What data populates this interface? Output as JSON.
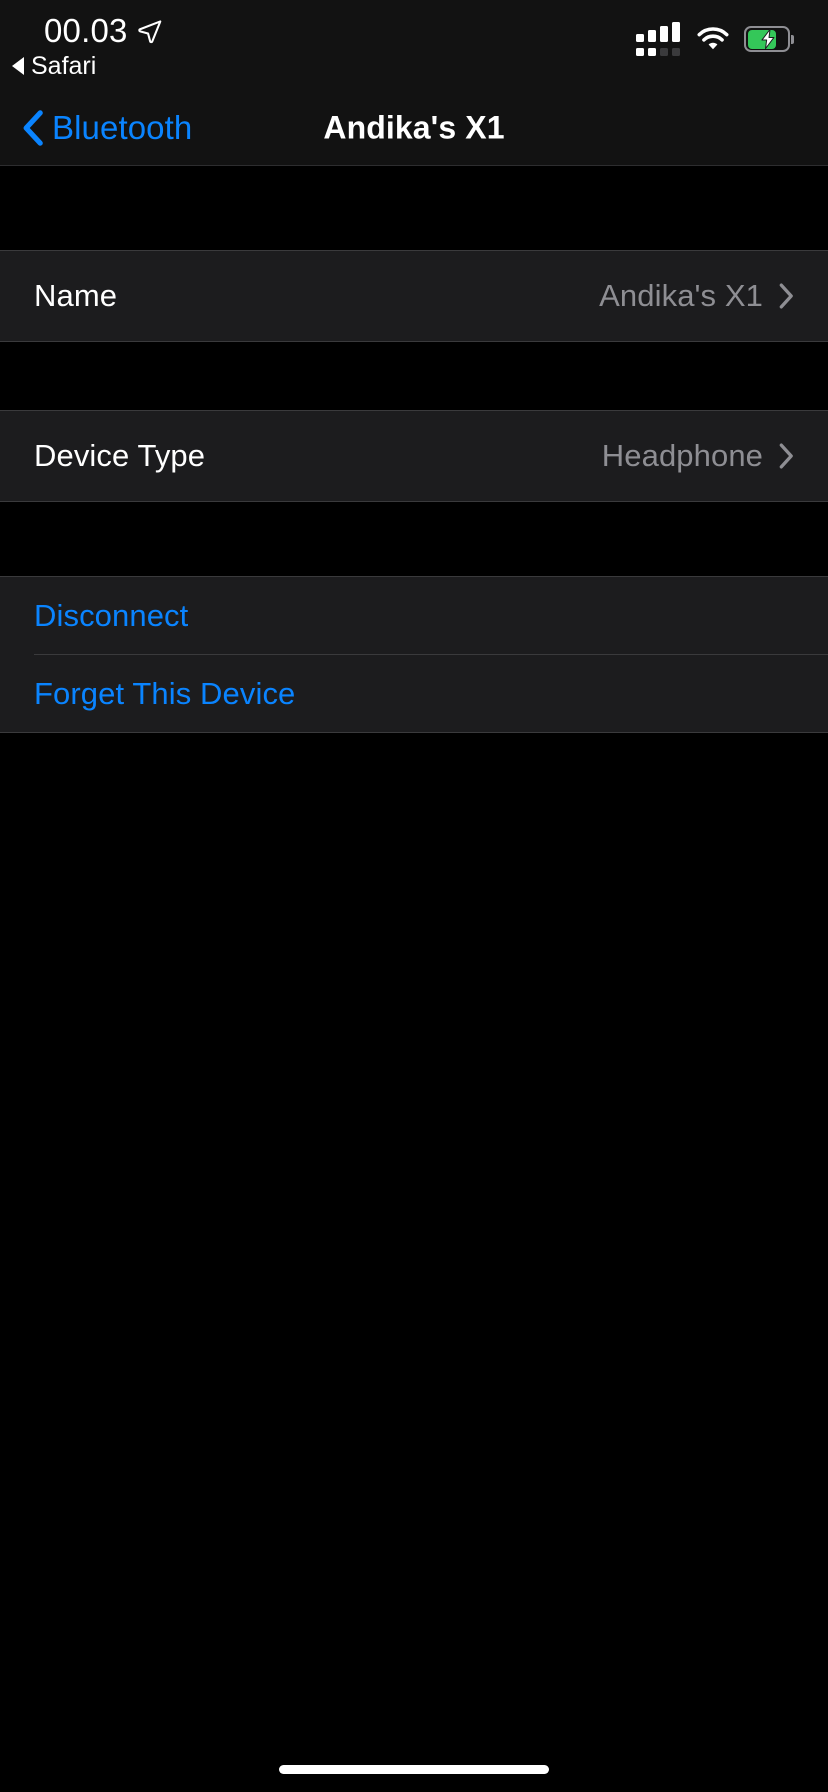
{
  "status_bar": {
    "time": "00.03",
    "location_icon": "location-arrow-icon",
    "return_app_label": "Safari",
    "return_icon": "back-triangle-icon",
    "cellular": {
      "icon": "dual-sim-signal-icon",
      "primary_bars_filled": 4,
      "primary_bars_total": 4,
      "secondary_bars_filled": 2,
      "secondary_bars_total": 4
    },
    "wifi": {
      "icon": "wifi-icon",
      "bars_filled": 3,
      "bars_total": 3
    },
    "battery": {
      "icon": "battery-charging-icon",
      "charging": true,
      "level_percent": 72,
      "fill_color": "#34c759",
      "outline_color": "#8e8e93"
    }
  },
  "nav_bar": {
    "back_icon": "chevron-left-icon",
    "back_label": "Bluetooth",
    "title": "Andika's X1"
  },
  "sections": {
    "name_group": {
      "rows": [
        {
          "label": "Name",
          "value": "Andika's X1",
          "accessory_icon": "chevron-right-icon"
        }
      ]
    },
    "device_type_group": {
      "rows": [
        {
          "label": "Device Type",
          "value": "Headphone",
          "accessory_icon": "chevron-right-icon"
        }
      ]
    },
    "actions_group": {
      "rows": [
        {
          "label": "Disconnect"
        },
        {
          "label": "Forget This Device"
        }
      ]
    }
  },
  "home_indicator": {
    "name": "home-indicator"
  },
  "colors": {
    "page_background": "#000000",
    "cell_background": "#1c1c1e",
    "bar_background": "#121212",
    "separator": "#3a3a3c",
    "accent_blue": "#0a84ff",
    "primary_text": "#ffffff",
    "secondary_text": "#8e8e93",
    "battery_green": "#34c759"
  }
}
